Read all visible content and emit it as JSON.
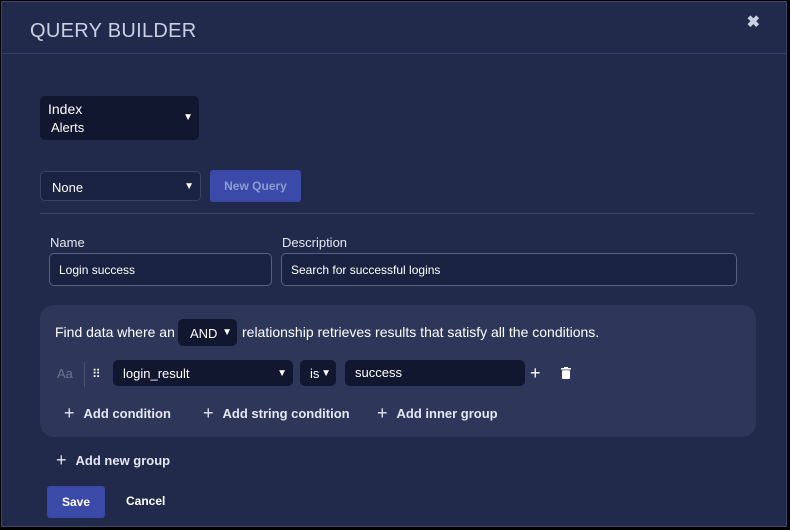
{
  "header": {
    "title": "QUERY BUILDER",
    "close_glyph": "✖"
  },
  "index_select": {
    "label": "Index",
    "value": "Alerts",
    "icon": "caret-down-icon"
  },
  "saved_query_select": {
    "value": "None",
    "icon": "caret-down-icon"
  },
  "new_query_button": {
    "label": "New Query"
  },
  "form": {
    "name_label": "Name",
    "name_value": "Login success",
    "description_label": "Description",
    "description_value": "Search for successful logins"
  },
  "group": {
    "text_before": "Find data where an",
    "operator": "AND",
    "text_after": "relationship retrieves results that satisfy all the conditions.",
    "condition": {
      "case_toggle": "Aa",
      "drag_glyph": "⠿",
      "field": "login_result",
      "comparator": "is",
      "value": "success"
    },
    "actions": {
      "add_condition": "Add condition",
      "add_string_condition": "Add string condition",
      "add_inner_group": "Add inner group"
    }
  },
  "add_new_group": "Add new group",
  "footer": {
    "save": "Save",
    "cancel": "Cancel"
  },
  "colors": {
    "background": "#212a4a",
    "primary_button": "#3b4aa8",
    "input_dark": "#10172e",
    "group_panel": "#2e375a"
  }
}
